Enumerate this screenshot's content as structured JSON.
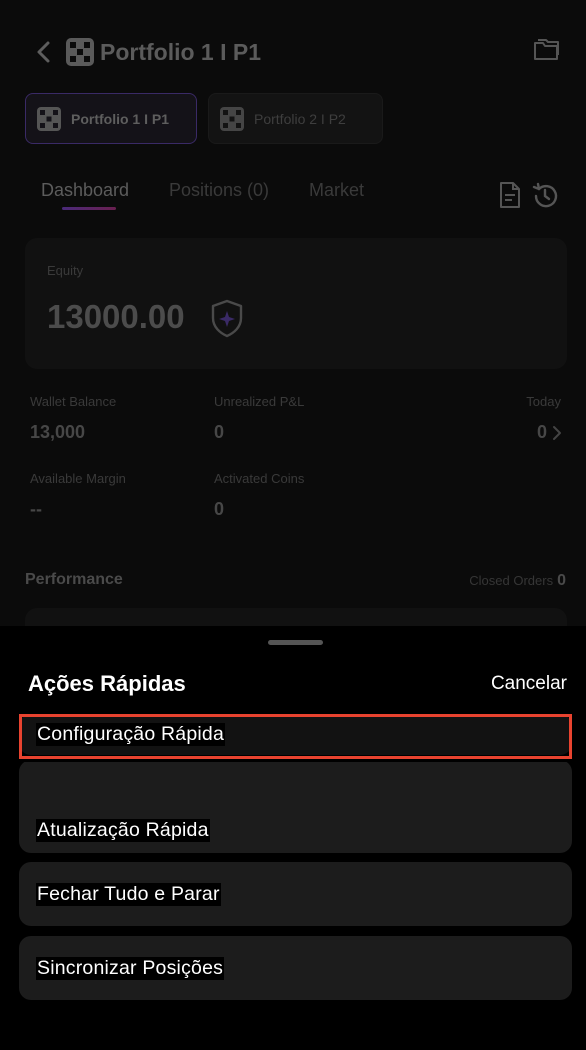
{
  "header": {
    "title": "Portfolio 1 I P1",
    "back_icon": "chevron-left-icon",
    "folder_icon": "folder-icon"
  },
  "portfolios": [
    {
      "label": "Portfolio 1 I P1",
      "active": true
    },
    {
      "label": "Portfolio 2 I P2",
      "active": false
    }
  ],
  "nav_tabs": [
    {
      "label": "Dashboard",
      "active": true
    },
    {
      "label": "Positions (0)",
      "active": false
    },
    {
      "label": "Market",
      "active": false
    }
  ],
  "equity": {
    "label": "Equity",
    "value": "13000.00"
  },
  "stats": {
    "wallet_balance": {
      "label": "Wallet Balance",
      "value": "13,000"
    },
    "unrealized_pnl": {
      "label": "Unrealized P&L",
      "value": "0"
    },
    "today": {
      "label": "Today",
      "value": "0"
    },
    "available_margin": {
      "label": "Available Margin",
      "value": "--"
    },
    "activated_coins": {
      "label": "Activated Coins",
      "value": "0"
    }
  },
  "performance": {
    "title": "Performance",
    "closed_orders_label": "Closed Orders",
    "closed_orders_value": "0"
  },
  "sheet": {
    "title": "Ações Rápidas",
    "cancel_label": "Cancelar",
    "actions": [
      {
        "label": "Configuração Rápida",
        "highlighted": true
      },
      {
        "label": "Atualização Rápida",
        "highlighted": false
      },
      {
        "label": "Fechar Tudo e Parar",
        "highlighted": false
      },
      {
        "label": "Sincronizar Posições",
        "highlighted": false
      }
    ]
  },
  "colors": {
    "highlight": "#e8432f",
    "accent_purple": "#4a2a7a"
  }
}
